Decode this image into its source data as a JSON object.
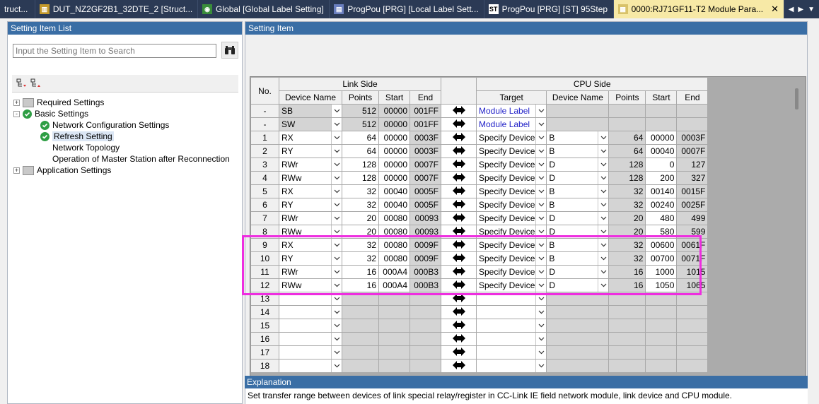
{
  "tabs": [
    {
      "label": "truct...",
      "icon": "none"
    },
    {
      "label": "DUT_NZ2GF2B1_32DTE_2 [Struct...",
      "icon": "struct-icon"
    },
    {
      "label": "Global [Global Label Setting]",
      "icon": "globe-icon"
    },
    {
      "label": "ProgPou [PRG] [Local Label Sett...",
      "icon": "local-label-icon"
    },
    {
      "label": "ProgPou [PRG] [ST] 95Step",
      "icon": "st-icon"
    },
    {
      "label": "0000:RJ71GF11-T2 Module Para...",
      "icon": "module-param-icon",
      "active": true
    }
  ],
  "left_panel": {
    "title": "Setting Item List",
    "search_placeholder": "Input the Setting Item to Search",
    "tree": [
      {
        "label": "Required Settings",
        "level": 0,
        "expander": "+"
      },
      {
        "label": "Basic Settings",
        "level": 0,
        "expander": "-"
      },
      {
        "label": "Network Configuration Settings",
        "level": 1
      },
      {
        "label": "Refresh Setting",
        "level": 1,
        "selected": true
      },
      {
        "label": "Network Topology",
        "level": 1
      },
      {
        "label": "Operation of Master Station after Reconnection",
        "level": 1
      },
      {
        "label": "Application Settings",
        "level": 0,
        "expander": "+"
      }
    ]
  },
  "right_panel": {
    "title": "Setting Item",
    "headers": {
      "no": "No.",
      "link_side": "Link Side",
      "cpu_side": "CPU Side",
      "device_name": "Device Name",
      "points": "Points",
      "start": "Start",
      "end": "End",
      "target": "Target",
      "cpu_device_name": "Device Name",
      "cpu_points": "Points",
      "cpu_start": "Start",
      "cpu_end": "End"
    },
    "rows": [
      {
        "no": "-",
        "dev": "SB",
        "pts": "512",
        "start": "00000",
        "end": "001FF",
        "target": "Module Label",
        "cdev": "",
        "cpts": "",
        "cstart": "",
        "cend": "",
        "fixed": true
      },
      {
        "no": "-",
        "dev": "SW",
        "pts": "512",
        "start": "00000",
        "end": "001FF",
        "target": "Module Label",
        "cdev": "",
        "cpts": "",
        "cstart": "",
        "cend": "",
        "fixed": true
      },
      {
        "no": "1",
        "dev": "RX",
        "pts": "64",
        "start": "00000",
        "end": "0003F",
        "target": "Specify Device",
        "cdev": "B",
        "cpts": "64",
        "cstart": "00000",
        "cend": "0003F"
      },
      {
        "no": "2",
        "dev": "RY",
        "pts": "64",
        "start": "00000",
        "end": "0003F",
        "target": "Specify Device",
        "cdev": "B",
        "cpts": "64",
        "cstart": "00040",
        "cend": "0007F"
      },
      {
        "no": "3",
        "dev": "RWr",
        "pts": "128",
        "start": "00000",
        "end": "0007F",
        "target": "Specify Device",
        "cdev": "D",
        "cpts": "128",
        "cstart": "0",
        "cend": "127"
      },
      {
        "no": "4",
        "dev": "RWw",
        "pts": "128",
        "start": "00000",
        "end": "0007F",
        "target": "Specify Device",
        "cdev": "D",
        "cpts": "128",
        "cstart": "200",
        "cend": "327"
      },
      {
        "no": "5",
        "dev": "RX",
        "pts": "32",
        "start": "00040",
        "end": "0005F",
        "target": "Specify Device",
        "cdev": "B",
        "cpts": "32",
        "cstart": "00140",
        "cend": "0015F"
      },
      {
        "no": "6",
        "dev": "RY",
        "pts": "32",
        "start": "00040",
        "end": "0005F",
        "target": "Specify Device",
        "cdev": "B",
        "cpts": "32",
        "cstart": "00240",
        "cend": "0025F"
      },
      {
        "no": "7",
        "dev": "RWr",
        "pts": "20",
        "start": "00080",
        "end": "00093",
        "target": "Specify Device",
        "cdev": "D",
        "cpts": "20",
        "cstart": "480",
        "cend": "499"
      },
      {
        "no": "8",
        "dev": "RWw",
        "pts": "20",
        "start": "00080",
        "end": "00093",
        "target": "Specify Device",
        "cdev": "D",
        "cpts": "20",
        "cstart": "580",
        "cend": "599"
      },
      {
        "no": "9",
        "dev": "RX",
        "pts": "32",
        "start": "00080",
        "end": "0009F",
        "target": "Specify Device",
        "cdev": "B",
        "cpts": "32",
        "cstart": "00600",
        "cend": "0061F"
      },
      {
        "no": "10",
        "dev": "RY",
        "pts": "32",
        "start": "00080",
        "end": "0009F",
        "target": "Specify Device",
        "cdev": "B",
        "cpts": "32",
        "cstart": "00700",
        "cend": "0071F"
      },
      {
        "no": "11",
        "dev": "RWr",
        "pts": "16",
        "start": "000A4",
        "end": "000B3",
        "target": "Specify Device",
        "cdev": "D",
        "cpts": "16",
        "cstart": "1000",
        "cend": "1015"
      },
      {
        "no": "12",
        "dev": "RWw",
        "pts": "16",
        "start": "000A4",
        "end": "000B3",
        "target": "Specify Device",
        "cdev": "D",
        "cpts": "16",
        "cstart": "1050",
        "cend": "1065"
      },
      {
        "no": "13",
        "empty": true
      },
      {
        "no": "14",
        "empty": true
      },
      {
        "no": "15",
        "empty": true
      },
      {
        "no": "16",
        "empty": true
      },
      {
        "no": "17",
        "empty": true
      },
      {
        "no": "18",
        "empty": true
      }
    ]
  },
  "explanation": {
    "title": "Explanation",
    "text": "Set transfer range between devices of link special relay/register in CC-Link IE field network module, link device and CPU module."
  },
  "colors": {
    "tabbar": "#2b3a55",
    "active_tab": "#f7e9a6",
    "panel_title": "#3a6ea5",
    "highlight": "#ee2ee0",
    "module_label": "#2323c8"
  }
}
